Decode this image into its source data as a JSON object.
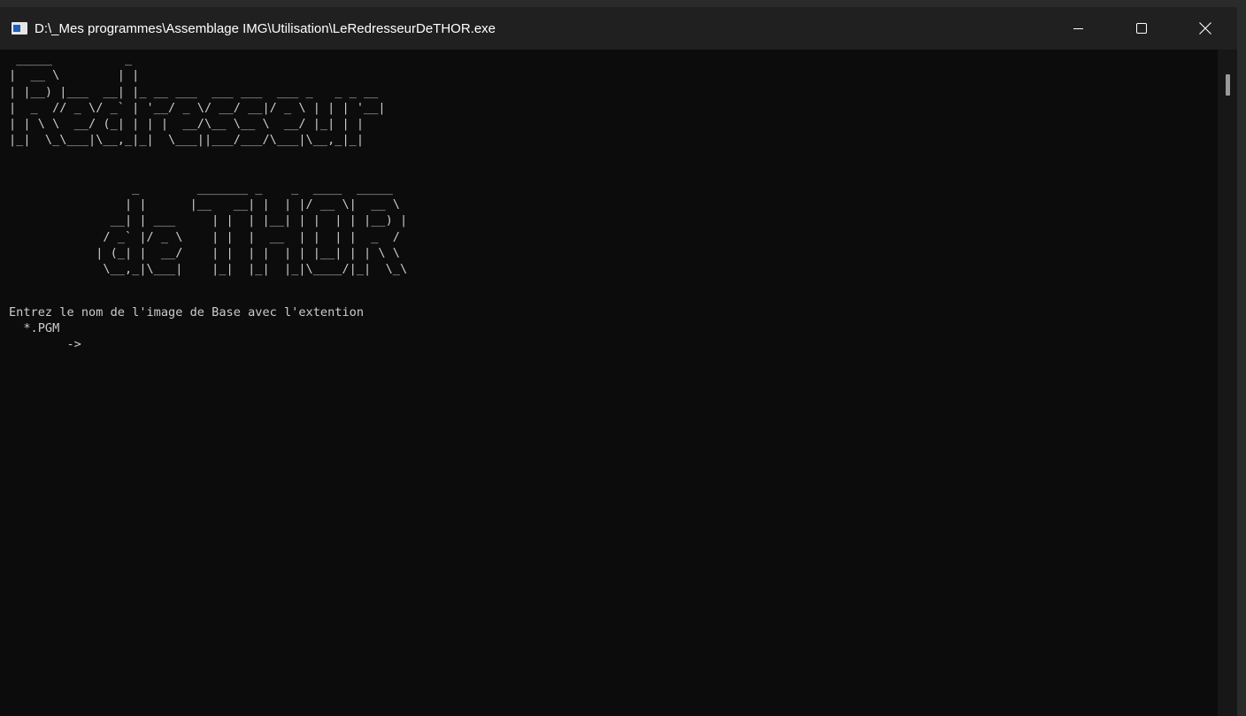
{
  "window": {
    "title": "D:\\_Mes programmes\\Assemblage IMG\\Utilisation\\LeRedresseurDeTHOR.exe",
    "icon": "console-app-icon",
    "controls": {
      "minimize_icon": "minimize-icon",
      "maximize_icon": "maximize-icon",
      "close_icon": "close-icon"
    }
  },
  "console": {
    "banner_redresseur": " _____          _\n|  __ \\        | |\n| |__) |___  __| |_ __ ___  ___ ___  ___ _   _ _ __\n|  _  // _ \\/ _` | '__/ _ \\/ __/ __|/ _ \\ | | | '__|\n| | \\ \\  __/ (_| | | |  __/\\__ \\__ \\  __/ |_| | |\n|_|  \\_\\___|\\__,_|_|  \\___||___/___/\\___|\\__,_|_|",
    "banner_dethor": "                 _        _______ _    _  ____  _____\n                | |      |__   __| |  | |/ __ \\|  __ \\\n              __| | ___     | |  | |__| | |  | | |__) |\n             / _` |/ _ \\    | |  |  __  | |  | |  _  /\n            | (_| |  __/    | |  | |  | | |__| | | \\ \\\n             \\__,_|\\___|    |_|  |_|  |_|\\____/|_|  \\_\\",
    "prompt_line1": "Entrez le nom de l'image de Base avec l'extention",
    "prompt_line2": "  *.PGM",
    "prompt_arrow": "        ->"
  },
  "colors": {
    "console_bg": "#0c0c0c",
    "console_fg": "#cccccc",
    "titlebar_bg": "#202020",
    "title_fg": "#ffffff"
  }
}
